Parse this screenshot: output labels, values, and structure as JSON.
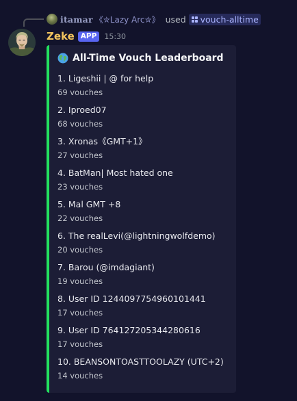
{
  "interaction": {
    "user": "𝐢𝐭𝐚𝐦𝐚𝐫",
    "user_tag": "《✮Lazy Arc✮》",
    "verb": "used",
    "command": "vouch-alltime"
  },
  "message": {
    "author": "Zeke",
    "badge": "APP",
    "timestamp": "15:30"
  },
  "embed": {
    "title": "All-Time Vouch Leaderboard",
    "accent_color": "#23e05f",
    "entries": [
      {
        "name": "1. Ligeshii | @ for help",
        "count": "69 vouches"
      },
      {
        "name": "2. Iproed07",
        "count": "68 vouches"
      },
      {
        "name": "3. Xronas《GMT+1》",
        "count": "27 vouches"
      },
      {
        "name": "4. BatMan| Most hated one",
        "count": "23 vouches"
      },
      {
        "name": "5. Mal GMT +8",
        "count": "22 vouches"
      },
      {
        "name": "6. The realLevi(@lightningwolfdemo)",
        "count": "20 vouches"
      },
      {
        "name": "7. Barou (@imdagiant)",
        "count": "19 vouches"
      },
      {
        "name": "8. User ID 1244097754960101441",
        "count": "17 vouches"
      },
      {
        "name": "9. User ID 764127205344280616",
        "count": "17 vouches"
      },
      {
        "name": "10. BEANSONTOASTTOOLAZY (UTC+2)",
        "count": "14 vouches"
      }
    ]
  },
  "colors": {
    "background": "#12132b",
    "embed_background": "#1c1d36",
    "author": "#f0c35e",
    "badge": "#5865f2",
    "command_chip": "#262a5a"
  }
}
